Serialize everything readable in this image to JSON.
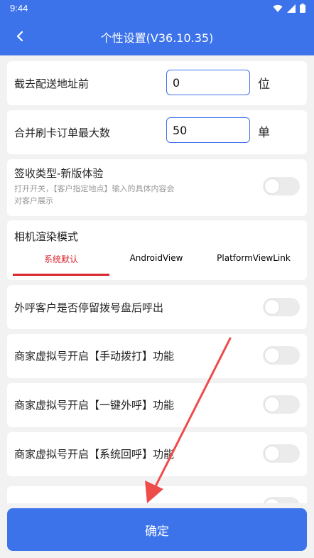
{
  "status": {
    "time": "9:44"
  },
  "header": {
    "back_icon": "arrow-left-icon",
    "title": "个性设置(V36.10.35)"
  },
  "rows": {
    "truncate": {
      "label": "截去配送地址前",
      "value": "0",
      "unit": "位"
    },
    "merge": {
      "label": "合并刷卡订单最大数",
      "value": "50",
      "unit": "单"
    },
    "sign_type": {
      "label": "签收类型-新版体验",
      "hint": "打开开关，【客户指定地点】输入的具体内容会对客户展示",
      "on": false
    },
    "camera": {
      "label": "相机渲染模式",
      "tabs": [
        "系统默认",
        "AndroidView",
        "PlatformViewLink"
      ],
      "selected": "系统默认"
    },
    "dial_wait": {
      "label": "外呼客户是否停留拨号盘后呼出",
      "on": false
    },
    "manual_dial": {
      "label": "商家虚拟号开启【手动拨打】功能",
      "on": false
    },
    "one_key": {
      "label": "商家虚拟号开启【一键外呼】功能",
      "on": false
    },
    "callback": {
      "label": "商家虚拟号开启【系统回呼】功能",
      "on": false
    },
    "partial": {
      "on": false
    }
  },
  "footer": {
    "confirm_label": "确定"
  },
  "colors": {
    "primary": "#3d73ea",
    "accent_red": "#d9272e",
    "annotation_arrow": "#ee4b4b"
  }
}
